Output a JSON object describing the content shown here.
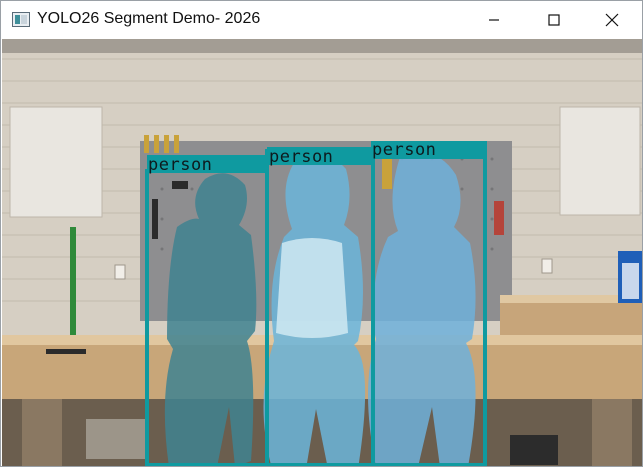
{
  "window": {
    "title": "YOLO26 Segment Demo- 2026",
    "icon": "app-window-icon",
    "controls": {
      "minimize": "minimize-icon",
      "maximize": "maximize-icon",
      "close": "close-icon"
    }
  },
  "colors": {
    "box": "#0f9aa0",
    "mask_blue": "#5aa7d6",
    "mask_teal": "#3a8f9a",
    "label_bg": "#0f9aa0",
    "label_text": "#0d1b1e"
  },
  "detections": [
    {
      "label": "person"
    },
    {
      "label": "person"
    },
    {
      "label": "person"
    }
  ]
}
